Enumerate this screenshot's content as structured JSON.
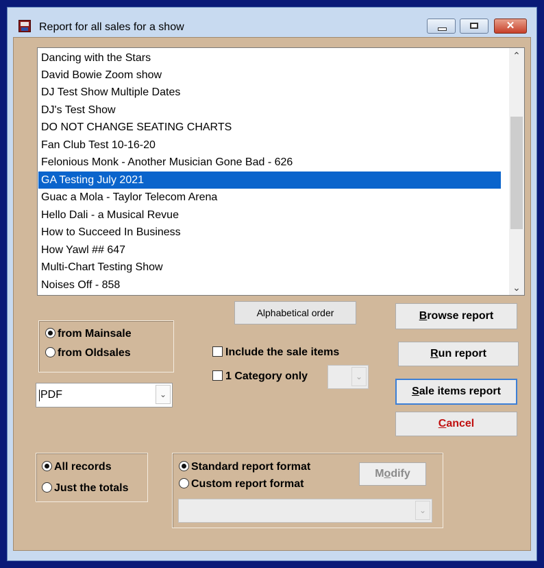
{
  "window": {
    "title": "Report for all sales for a show",
    "controls": {
      "minimize": "minimize",
      "maximize": "maximize",
      "close": "✕"
    }
  },
  "show_list": {
    "items": [
      "Dancing with the Stars",
      "David Bowie Zoom show",
      "DJ Test Show Multiple Dates",
      "DJ's Test Show",
      "DO NOT CHANGE SEATING CHARTS",
      "Fan Club Test 10-16-20",
      "Felonious Monk - Another Musician Gone Bad - 626",
      "GA Testing July 2021",
      "Guac a Mola - Taylor Telecom Arena",
      "Hello Dali - a Musical Revue",
      "How to Succeed In Business",
      "How Yawl ## 647",
      "Multi-Chart Testing Show",
      "Noises Off - 858"
    ],
    "selected": "GA Testing July 2021",
    "scroll_up": "⌃",
    "scroll_down": "⌄"
  },
  "buttons": {
    "alphabetical": "Alphabetical order",
    "browse": {
      "key": "B",
      "rest": "rowse report"
    },
    "run": {
      "key": "R",
      "rest": "un report"
    },
    "sale_items": {
      "key": "S",
      "rest": "ale items report"
    },
    "cancel": {
      "key": "C",
      "rest": "ancel"
    },
    "modify": {
      "pre": "M",
      "key": "o",
      "rest": "dify"
    }
  },
  "source": {
    "options": [
      "from Mainsale",
      "from Oldsales"
    ],
    "selected": "from Mainsale"
  },
  "options": {
    "include_sale_items": {
      "label": "Include the sale items",
      "checked": false
    },
    "one_category": {
      "label": "1 Category only",
      "checked": false
    }
  },
  "output_format": {
    "value": "PDF"
  },
  "records": {
    "options": [
      "All records",
      "Just the totals"
    ],
    "selected": "All records"
  },
  "report_format": {
    "options": [
      "Standard report format",
      "Custom report format"
    ],
    "selected": "Standard report format"
  },
  "colors": {
    "desktop": "#0a1a78",
    "client_bg": "#d1b89b",
    "selection": "#0a64cc",
    "cancel_text": "#c01010"
  }
}
